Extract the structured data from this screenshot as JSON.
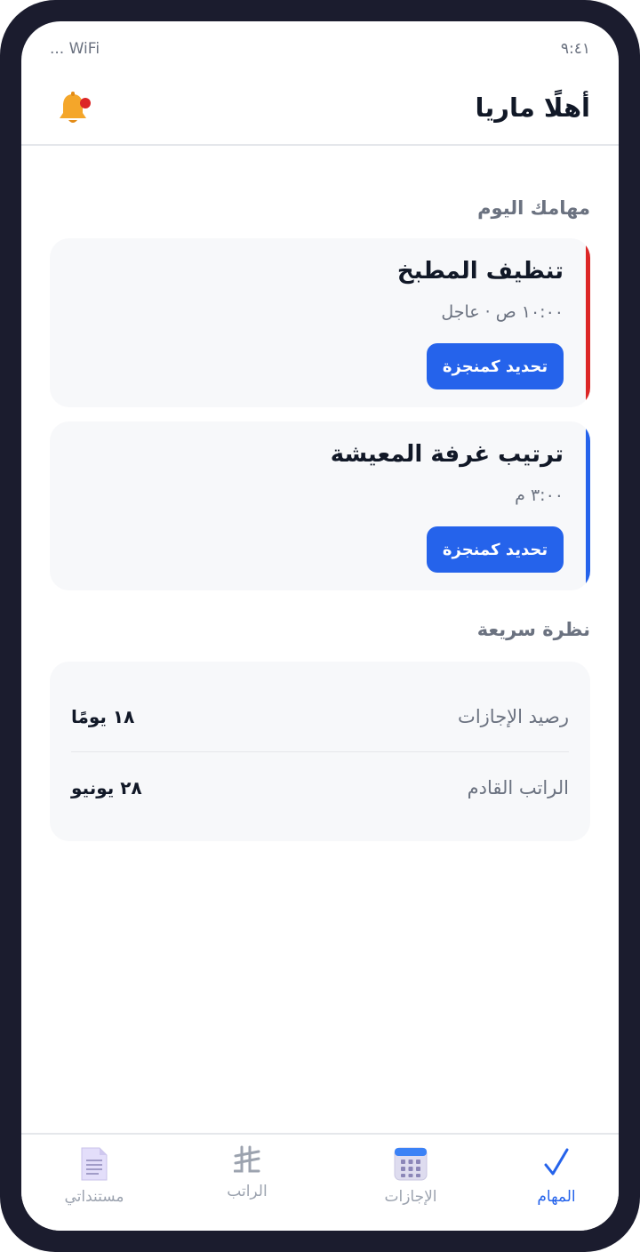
{
  "status_bar": {
    "time": "٩:٤١",
    "network": "WiFi ..."
  },
  "header": {
    "greeting": "أهلًا ماريا",
    "notification_icon": "bell-icon"
  },
  "tasks_section": {
    "title": "مهامك اليوم",
    "tasks": [
      {
        "title": "تنظيف المطبخ",
        "meta": "١٠:٠٠ ص · عاجل",
        "button_label": "تحديد كمنجزة",
        "accent_color": "#dc2626"
      },
      {
        "title": "ترتيب غرفة المعيشة",
        "meta": "٣:٠٠ م",
        "button_label": "تحديد كمنجزة",
        "accent_color": "#2563eb"
      }
    ]
  },
  "overview": {
    "title": "نظرة سريعة",
    "rows": [
      {
        "label": "رصيد الإجازات",
        "value": "١٨ يومًا"
      },
      {
        "label": "الراتب القادم",
        "value": "٢٨ يونيو"
      }
    ]
  },
  "bottom_nav": {
    "items": [
      {
        "label": "المهام",
        "icon": "checkmark-icon",
        "active": true
      },
      {
        "label": "الإجازات",
        "icon": "calendar-icon",
        "active": false
      },
      {
        "label": "الراتب",
        "icon": "riyal-icon",
        "active": false
      },
      {
        "label": "مستنداتي",
        "icon": "document-icon",
        "active": false
      }
    ]
  },
  "colors": {
    "primary": "#2563eb",
    "urgent": "#dc2626",
    "frame": "#1b1c2e"
  }
}
